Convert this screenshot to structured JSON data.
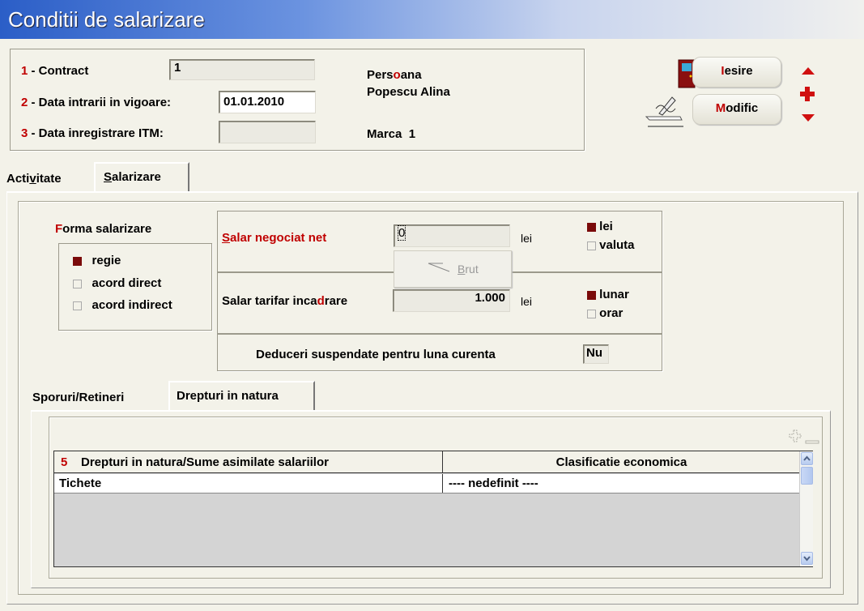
{
  "window": {
    "title": "Conditii de salarizare"
  },
  "header": {
    "contract_num": "1",
    "contract_label": " - Contract",
    "contract_value": "1",
    "data_intrarii_num": "2",
    "data_intrarii_label": " - Data intrarii in vigoare:",
    "data_intrarii_value": "01.01.2010",
    "data_itm_num": "3",
    "data_itm_label": " - Data inregistrare ITM:",
    "data_itm_value": "",
    "persoana_pre": "Pers",
    "persoana_hot": "o",
    "persoana_post": "ana",
    "persoana_name": "Popescu Alina",
    "marca_label": "Marca",
    "marca_value": "1"
  },
  "buttons": {
    "iesire_hot": "I",
    "iesire_rest": "esire",
    "modific_hot": "M",
    "modific_rest": "odific"
  },
  "tabs": {
    "activitate_pre": "Acti",
    "activitate_hot": "v",
    "activitate_post": "itate",
    "salarizare_hot": "S",
    "salarizare_rest": "alarizare"
  },
  "forma": {
    "title_hot": "F",
    "title_rest": "orma salarizare",
    "options": [
      {
        "label": "regie",
        "checked": true
      },
      {
        "label": "acord direct",
        "checked": false
      },
      {
        "label": "acord indirect",
        "checked": false
      }
    ]
  },
  "salar": {
    "negociat_hot": "S",
    "negociat_rest": "alar negociat net",
    "negociat_value": "0",
    "lei1": "lei",
    "brut_hot": "B",
    "brut_rest": "rut",
    "tarifar_pre": "Salar tarifar inca",
    "tarifar_hot": "d",
    "tarifar_post": "rare",
    "tarifar_value": "1.000",
    "lei2": "lei",
    "moneda": [
      {
        "label": "lei",
        "checked": true
      },
      {
        "label": "valuta",
        "checked": false
      }
    ],
    "perioada": [
      {
        "label": "lunar",
        "checked": true
      },
      {
        "label": "orar",
        "checked": false
      }
    ],
    "deduceri_label": "Deduceri suspendate pentru luna curenta",
    "deduceri_value": "Nu"
  },
  "subtabs": {
    "sporuri": "Sporuri/Retineri",
    "drepturi": "Drepturi in natura"
  },
  "grid": {
    "num": "5",
    "col1": "Drepturi in natura/Sume asimilate salariilor",
    "col2": "Clasificatie economica",
    "rows": [
      {
        "c1": "Tichete",
        "c2": "---- nedefinit ----"
      }
    ]
  },
  "colors": {
    "accent_red": "#c00000",
    "check_on": "#7a0a0a",
    "title_blue": "#2b5ec7"
  }
}
